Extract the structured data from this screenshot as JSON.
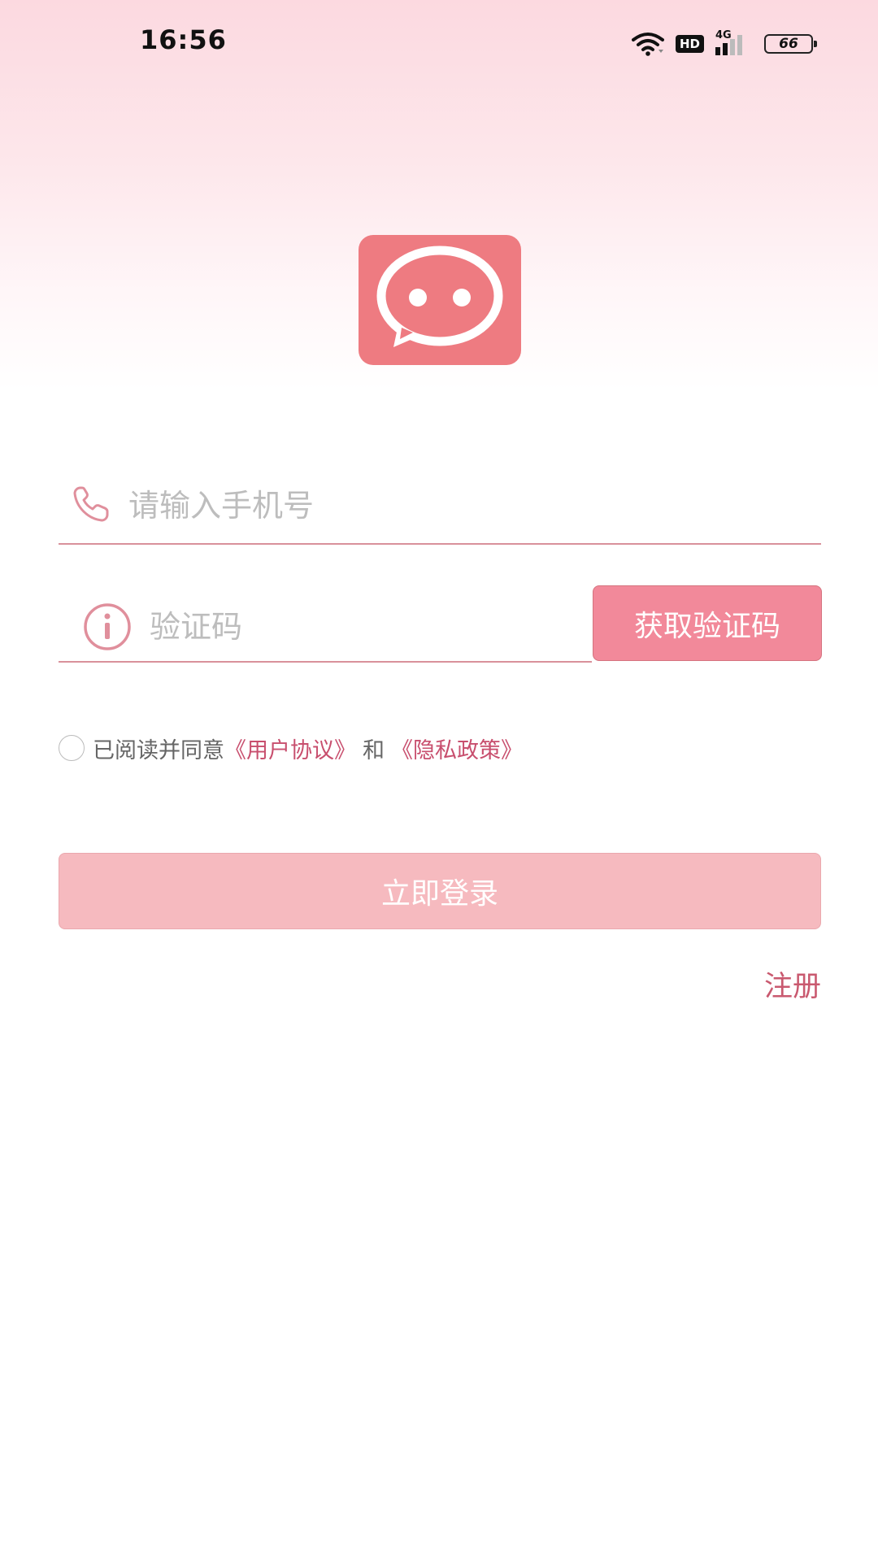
{
  "status_bar": {
    "time": "16:56",
    "hd": "HD",
    "network": "4G",
    "battery": "66"
  },
  "login": {
    "phone_placeholder": "请输入手机号",
    "code_placeholder": "验证码",
    "get_code_label": "获取验证码",
    "agreement_prefix": "已阅读并同意",
    "user_agreement": "《用户协议》",
    "agreement_and": "和",
    "privacy_policy": "《隐私政策》",
    "login_label": "立即登录",
    "register_label": "注册"
  },
  "colors": {
    "accent": "#f2899a",
    "logo": "#ee7b81",
    "login_button": "#f6babf",
    "link": "#c84f6e"
  }
}
